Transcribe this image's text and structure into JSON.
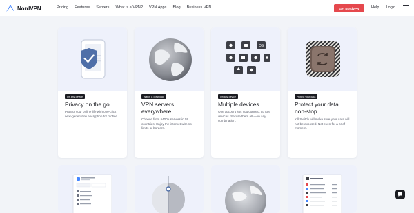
{
  "nav": {
    "logo_text": "NordVPN",
    "links": [
      "Pricing",
      "Features",
      "Servers",
      "What is a VPN?",
      "VPN Apps",
      "Blog",
      "Business VPN"
    ],
    "cta_label": "Get NordVPN",
    "help_label": "Help",
    "login_label": "Login"
  },
  "cards": [
    {
      "badge": "On any device",
      "title": "Privacy on the go",
      "description": "Protect your online life with one-click next-generation encryption for mobile."
    },
    {
      "badge": "Watch & download",
      "title_line1": "VPN servers",
      "title_line2": "everywhere",
      "description": "Choose from 5400+ servers in 59 countries. Enjoy the internet with no limits or borders."
    },
    {
      "badge": "On any device",
      "title": "Multiple devices",
      "description": "One account lets you connect up to 6 devices. Secure them all — in any combination."
    },
    {
      "badge": "Protect your data",
      "title_line1": "Protect your data",
      "title_line2": "non-stop",
      "description": "Kill Switch will make sure your data will not be exposed. Not even for a brief moment."
    }
  ],
  "colors": {
    "accent": "#e5484d",
    "ink": "#1b1c22",
    "brand_blue": "#4687ff",
    "card_art_bg": "#eef1fb"
  }
}
